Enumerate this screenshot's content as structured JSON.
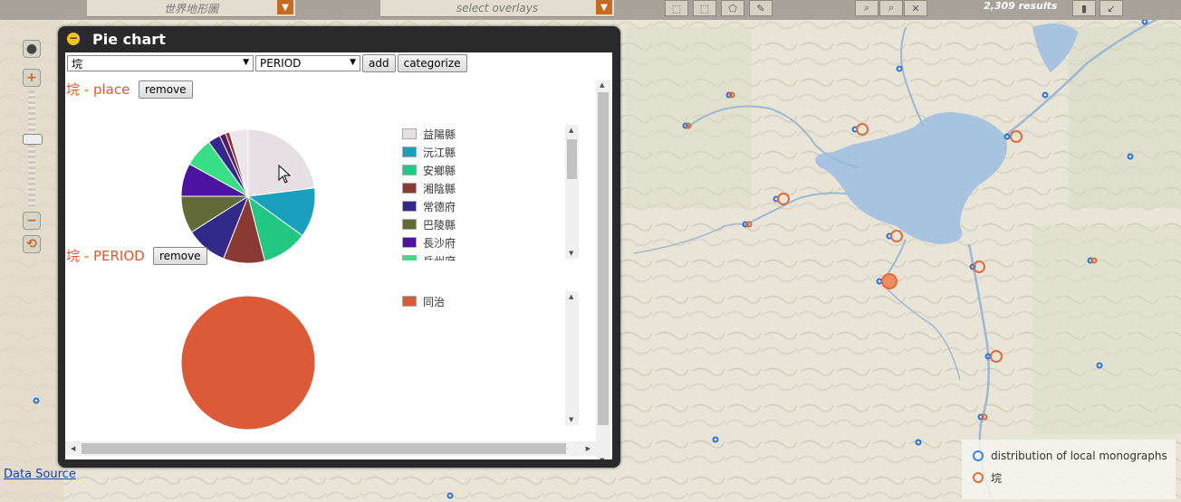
{
  "topbar": {
    "basemap_select": "世界地形圖",
    "overlay_select": "select overlays",
    "results": "2,309 results"
  },
  "data_source_link": "Data Source",
  "legend": {
    "items": [
      {
        "label": "distribution of local monographs",
        "color": "#3b86d8"
      },
      {
        "label": "垸",
        "color": "#e46a3a"
      }
    ]
  },
  "pie_window": {
    "title": "Pie chart",
    "field_select": "垸",
    "category_select": "PERIOD",
    "add_label": "add",
    "categorize_label": "categorize",
    "remove_label": "remove",
    "sections": [
      {
        "label": "垸 - place",
        "legend": [
          {
            "name": "益陽縣",
            "color": "#e6dfe3"
          },
          {
            "name": "沅江縣",
            "color": "#1a9fbd"
          },
          {
            "name": "安鄉縣",
            "color": "#22c882"
          },
          {
            "name": "湘陰縣",
            "color": "#8a3a33"
          },
          {
            "name": "常德府",
            "color": "#322989"
          },
          {
            "name": "巴陵縣",
            "color": "#626b36"
          },
          {
            "name": "長沙府",
            "color": "#4c12a0"
          },
          {
            "name": "岳州府",
            "color": "#37df87"
          }
        ]
      },
      {
        "label": "垸 - PERIOD",
        "legend": [
          {
            "name": "同治",
            "color": "#db5a38"
          }
        ]
      }
    ]
  },
  "chart_data": [
    {
      "type": "pie",
      "title": "垸 - place",
      "slices": [
        {
          "name": "益陽縣",
          "value": 23,
          "color": "#e6dfe3"
        },
        {
          "name": "沅江縣",
          "value": 12,
          "color": "#1a9fbd"
        },
        {
          "name": "安鄉縣",
          "value": 11,
          "color": "#22c882"
        },
        {
          "name": "湘陰縣",
          "value": 10,
          "color": "#8a3a33"
        },
        {
          "name": "常德府",
          "value": 10,
          "color": "#322989"
        },
        {
          "name": "巴陵縣",
          "value": 9,
          "color": "#626b36"
        },
        {
          "name": "長沙府",
          "value": 8,
          "color": "#4c12a0"
        },
        {
          "name": "岳州府",
          "value": 7,
          "color": "#37df87"
        },
        {
          "name": "",
          "value": 3,
          "color": "#322989"
        },
        {
          "name": "",
          "value": 1.5,
          "color": "#5a1a5e"
        },
        {
          "name": "",
          "value": 1,
          "color": "#8a3a33"
        },
        {
          "name": "",
          "value": 4.5,
          "color": "#ece6ea"
        }
      ]
    },
    {
      "type": "pie",
      "title": "垸 - PERIOD",
      "slices": [
        {
          "name": "同治",
          "value": 100,
          "color": "#db5a38"
        }
      ]
    }
  ]
}
